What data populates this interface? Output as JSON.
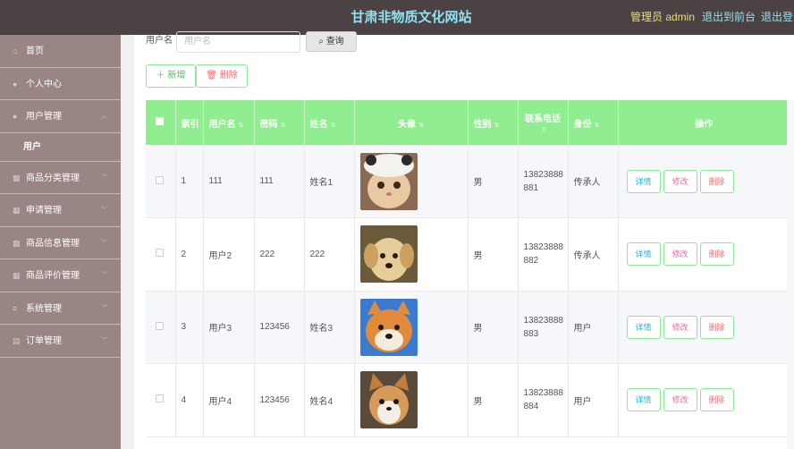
{
  "header": {
    "title": "甘肃非物质文化网站",
    "admin_label": "管理员 admin",
    "back_front_label": "退出到前台",
    "logout_label": "退出登录"
  },
  "sidebar": {
    "items": [
      {
        "label": "首页",
        "icon": "home-icon"
      },
      {
        "label": "个人中心",
        "icon": "user-icon"
      },
      {
        "label": "用户管理",
        "icon": "user-icon"
      },
      {
        "label": "用户",
        "sub": true
      },
      {
        "label": "商品分类管理",
        "icon": "grid-icon"
      },
      {
        "label": "申请管理",
        "icon": "grid-icon"
      },
      {
        "label": "商品信息管理",
        "icon": "grid-icon"
      },
      {
        "label": "商品评价管理",
        "icon": "grid-icon"
      },
      {
        "label": "系统管理",
        "icon": "menu-icon"
      },
      {
        "label": "订单管理",
        "icon": "chart-icon"
      }
    ]
  },
  "search": {
    "label": "用户名",
    "placeholder": "用户名",
    "button_label": "查询"
  },
  "actions": {
    "add_label": "新增",
    "delete_label": "删除"
  },
  "table": {
    "columns": [
      "索引",
      "用户名",
      "密码",
      "姓名",
      "头像",
      "性别",
      "联系电话",
      "身份",
      "操作"
    ],
    "rows": [
      {
        "index": "1",
        "username": "111",
        "password": "111",
        "name": "姓名1",
        "gender": "男",
        "phone": "13823888881",
        "role": "传承人",
        "avatar": "cat"
      },
      {
        "index": "2",
        "username": "用户2",
        "password": "222",
        "name": "222",
        "gender": "男",
        "phone": "13823888882",
        "role": "传承人",
        "avatar": "puppy"
      },
      {
        "index": "3",
        "username": "用户3",
        "password": "123456",
        "name": "姓名3",
        "gender": "男",
        "phone": "13823888883",
        "role": "用户",
        "avatar": "shiba"
      },
      {
        "index": "4",
        "username": "用户4",
        "password": "123456",
        "name": "姓名4",
        "gender": "男",
        "phone": "13823888884",
        "role": "用户",
        "avatar": "corgi"
      }
    ],
    "row_actions": {
      "detail": "详情",
      "edit": "修改",
      "remove": "删除"
    }
  },
  "colors": {
    "topbar": "#4a4243",
    "title": "#8fe2f0",
    "sidebar": "#9a8585",
    "table_header": "#90ee90"
  }
}
